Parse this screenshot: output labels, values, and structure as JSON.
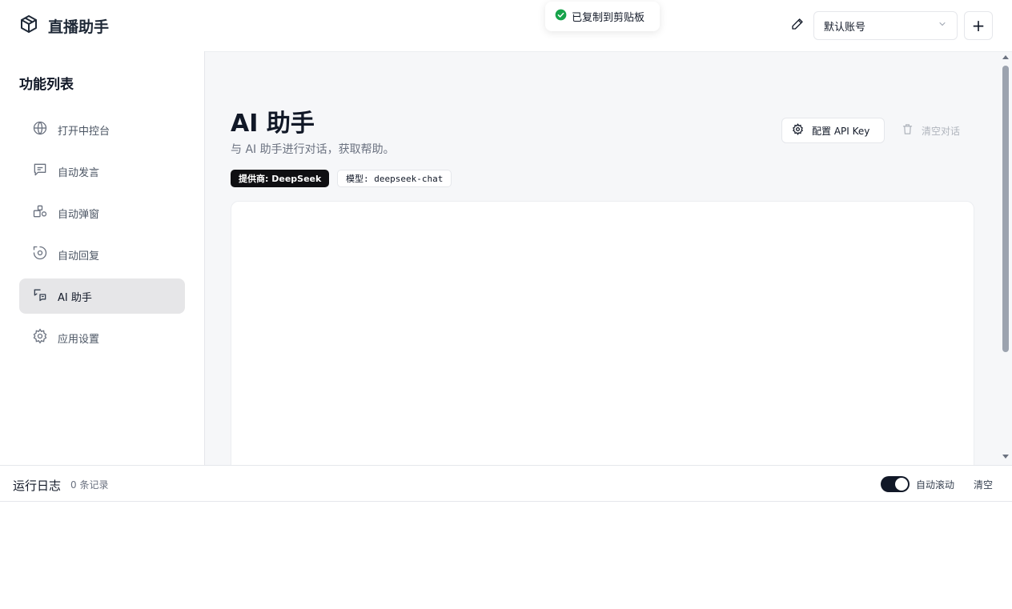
{
  "header": {
    "app_title": "直播助手",
    "account_selected": "默认账号",
    "add_label": "+"
  },
  "toast": {
    "message": "已复制到剪贴板"
  },
  "sidebar": {
    "title": "功能列表",
    "items": [
      {
        "label": "打开中控台",
        "icon": "globe-icon"
      },
      {
        "label": "自动发言",
        "icon": "message-icon"
      },
      {
        "label": "自动弹窗",
        "icon": "package-icon"
      },
      {
        "label": "自动回复",
        "icon": "reply-icon"
      },
      {
        "label": "AI 助手",
        "icon": "ai-chat-icon",
        "active": true
      },
      {
        "label": "应用设置",
        "icon": "gear-icon"
      }
    ]
  },
  "main": {
    "title": "AI 助手",
    "description": "与 AI 助手进行对话，获取帮助。",
    "provider_tag": "提供商: DeepSeek",
    "model_tag": "模型: deepseek-chat",
    "api_button": "配置 API Key",
    "clear_button": "清空对话"
  },
  "logbar": {
    "title": "运行日志",
    "count": "0 条记录",
    "autoscroll_label": "自动滚动",
    "autoscroll_on": true,
    "clear_label": "清空"
  },
  "colors": {
    "accent_dark": "#111827",
    "toast_success": "#16a34a",
    "active_nav_bg": "#e6e6e8",
    "main_bg": "#f6f7f9"
  }
}
